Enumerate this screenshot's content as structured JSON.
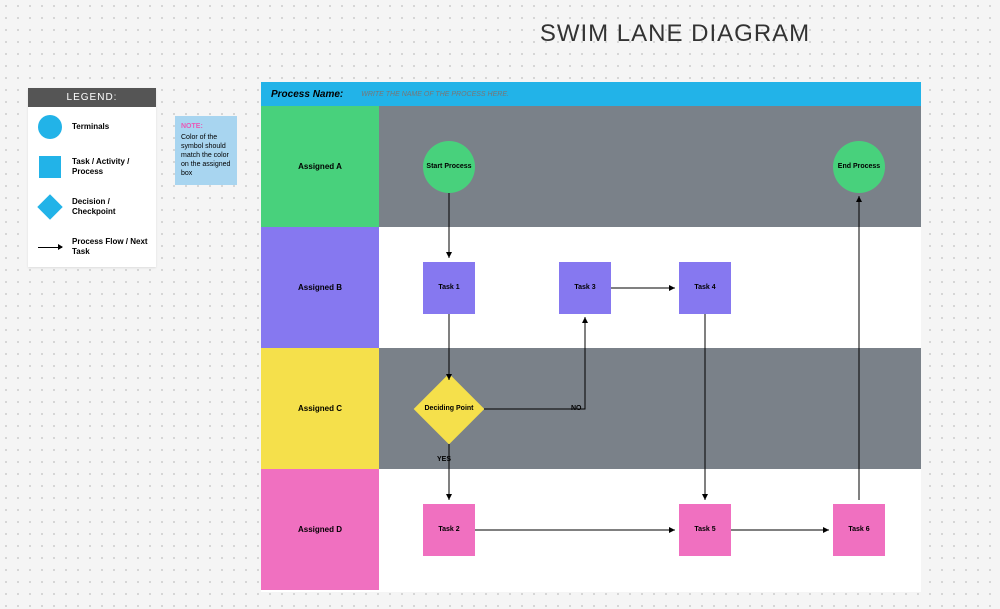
{
  "title": "SWIM LANE DIAGRAM",
  "legend": {
    "heading": "LEGEND:",
    "terminals": "Terminals",
    "task": "Task / Activity / Process",
    "decision": "Decision / Checkpoint",
    "flow": "Process Flow / Next Task"
  },
  "note": {
    "title": "NOTE:",
    "body": "Color of the symbol should match the color on the assigned box"
  },
  "process_name_label": "Process Name:",
  "process_name_hint": "WRITE THE NAME OF THE PROCESS HERE.",
  "lanes": {
    "a": "Assigned A",
    "b": "Assigned B",
    "c": "Assigned C",
    "d": "Assigned D"
  },
  "nodes": {
    "start": "Start Process",
    "end": "End Process",
    "task1": "Task 1",
    "task2": "Task 2",
    "task3": "Task 3",
    "task4": "Task 4",
    "task5": "Task 5",
    "task6": "Task 6",
    "decide": "Deciding Point"
  },
  "labels": {
    "yes": "YES",
    "no": "NO"
  },
  "swimlane": {
    "lanes": [
      {
        "id": "A",
        "label": "Assigned A",
        "color": "#48d17c"
      },
      {
        "id": "B",
        "label": "Assigned B",
        "color": "#8678f0"
      },
      {
        "id": "C",
        "label": "Assigned C",
        "color": "#f5e04b"
      },
      {
        "id": "D",
        "label": "Assigned D",
        "color": "#f070c0"
      }
    ],
    "nodes": [
      {
        "id": "start",
        "lane": "A",
        "type": "terminal",
        "label": "Start Process"
      },
      {
        "id": "task1",
        "lane": "B",
        "type": "task",
        "label": "Task 1"
      },
      {
        "id": "decide",
        "lane": "C",
        "type": "decision",
        "label": "Deciding Point"
      },
      {
        "id": "task2",
        "lane": "D",
        "type": "task",
        "label": "Task 2"
      },
      {
        "id": "task3",
        "lane": "B",
        "type": "task",
        "label": "Task 3"
      },
      {
        "id": "task4",
        "lane": "B",
        "type": "task",
        "label": "Task 4"
      },
      {
        "id": "task5",
        "lane": "D",
        "type": "task",
        "label": "Task 5"
      },
      {
        "id": "task6",
        "lane": "D",
        "type": "task",
        "label": "Task 6"
      },
      {
        "id": "end",
        "lane": "A",
        "type": "terminal",
        "label": "End Process"
      }
    ],
    "edges": [
      {
        "from": "start",
        "to": "task1"
      },
      {
        "from": "task1",
        "to": "decide"
      },
      {
        "from": "decide",
        "to": "task2",
        "label": "YES"
      },
      {
        "from": "decide",
        "to": "task3",
        "label": "NO"
      },
      {
        "from": "task3",
        "to": "task4"
      },
      {
        "from": "task4",
        "to": "task5"
      },
      {
        "from": "task2",
        "to": "task5"
      },
      {
        "from": "task5",
        "to": "task6"
      },
      {
        "from": "task6",
        "to": "end"
      }
    ]
  }
}
